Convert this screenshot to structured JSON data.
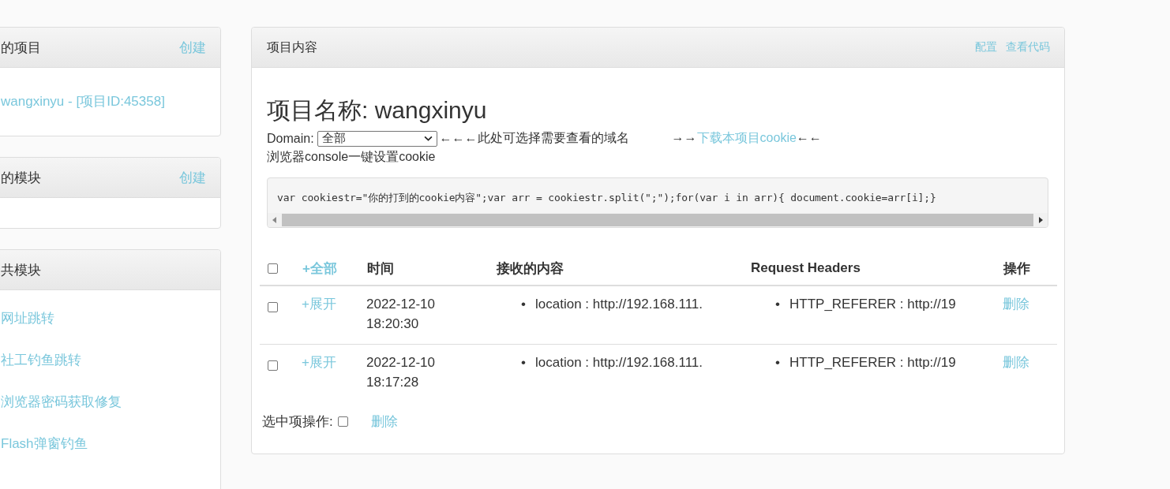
{
  "sidebar": {
    "panels": [
      {
        "title": "的项目",
        "action": "创建",
        "items": [
          {
            "label": "wangxinyu - [项目ID:45358]"
          }
        ]
      },
      {
        "title": "的模块",
        "action": "创建"
      },
      {
        "title": "共模块",
        "items": [
          {
            "label": "网址跳转"
          },
          {
            "label": "社工钓鱼跳转"
          },
          {
            "label": "浏览器密码获取修复"
          },
          {
            "label": "Flash弹窗钓鱼"
          }
        ]
      }
    ]
  },
  "main": {
    "title": "项目内容",
    "links": [
      "配置",
      "查看代码"
    ],
    "heading": "项目名称: wangxinyu",
    "domain": {
      "label": "Domain:",
      "value": "全部"
    },
    "hint": "←←←此处可选择需要查看的域名",
    "download": {
      "prefix": "→→",
      "link": "下载本项目cookie",
      "suffix": "←←"
    },
    "console_label": "浏览器console一键设置cookie",
    "code": "var cookiestr=\"你的打到的cookie内容\";var arr = cookiestr.split(\";\");for(var i in arr){ document.cookie=arr[i];}",
    "table": {
      "bullet": "•",
      "select_all": {
        "checked": false
      },
      "expand_all": "+全部",
      "columns": [
        "时间",
        "接收的内容",
        "Request Headers",
        "操作"
      ],
      "rows": [
        {
          "checked": false,
          "expand": "+展开",
          "time": "2022-12-10 18:20:30",
          "content": [
            "location : http://192.168.111."
          ],
          "headers": [
            "HTTP_REFERER : http://19"
          ],
          "action": "删除"
        },
        {
          "checked": false,
          "expand": "+展开",
          "time": "2022-12-10 18:17:28",
          "content": [
            "location : http://192.168.111."
          ],
          "headers": [
            "HTTP_REFERER : http://19"
          ],
          "action": "删除"
        }
      ]
    },
    "footer": {
      "label": "选中项操作:",
      "checked": false,
      "action": "删除"
    }
  }
}
